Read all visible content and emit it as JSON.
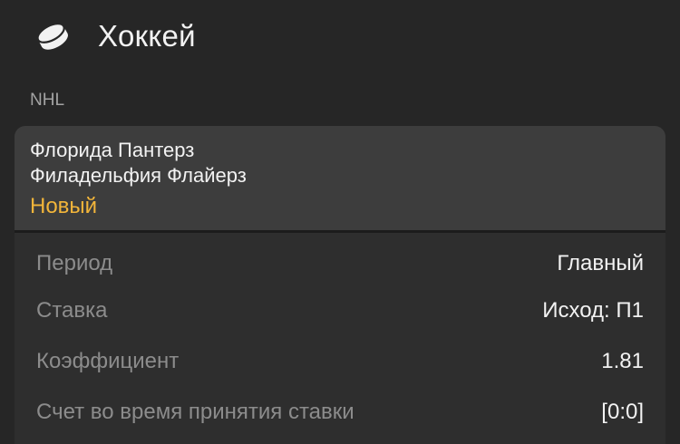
{
  "header": {
    "icon": "hockey-puck-icon",
    "title": "Хоккей"
  },
  "league": "NHL",
  "event": {
    "team_home": "Флорида Пантерз",
    "team_away": "Филадельфия Флайерз",
    "status": "Новый",
    "status_color": "#f2b53a"
  },
  "details": [
    {
      "label": "Период",
      "value": "Главный"
    },
    {
      "label": "Ставка",
      "value": "Исход: П1"
    },
    {
      "label": "Коэффициент",
      "value": "1.81"
    },
    {
      "label": "Счет во время принятия ставки",
      "value": "[0:0]"
    }
  ],
  "colors": {
    "background": "#262626",
    "card_header": "#3d3d3d",
    "card_body": "#2e2e2e",
    "label": "#8c8c8c",
    "text": "#f2f2f2"
  }
}
